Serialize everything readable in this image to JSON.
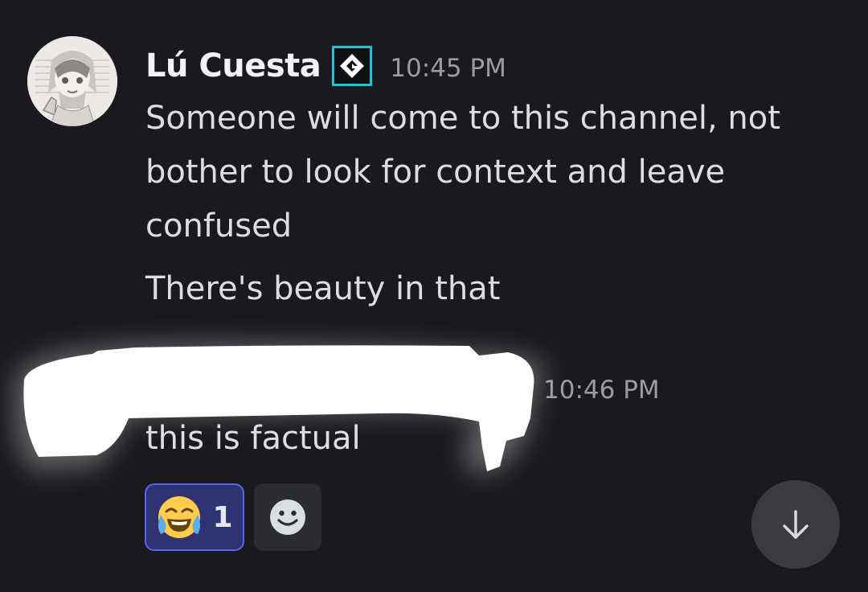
{
  "message1": {
    "username": "Lú Cuesta",
    "badge_icon": "gamemaker-logo-icon",
    "timestamp": "10:45 PM",
    "lines": [
      "Someone will come to this channel, not bother to look for context and leave confused",
      "There's beauty in that"
    ]
  },
  "message2": {
    "timestamp": "10:46 PM",
    "text": "this is factual"
  },
  "reactions": [
    {
      "emoji": "joy-emoji",
      "count": "1",
      "selected": true
    }
  ],
  "add_reaction_icon": "smile-icon",
  "jump_button_icon": "arrow-down-icon",
  "colors": {
    "background": "#1a1a1e",
    "accent": "#5865f2",
    "badge_border": "#17c7d6"
  }
}
